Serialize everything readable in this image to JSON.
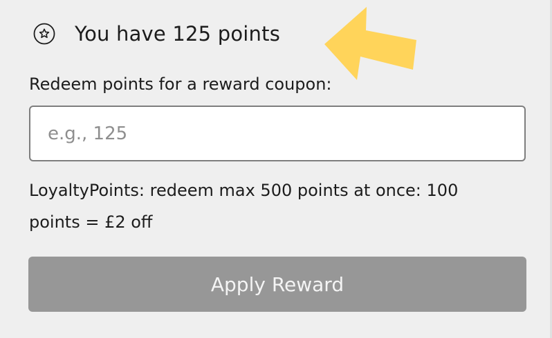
{
  "loyalty": {
    "points_message": "You have 125 points",
    "star_icon": "star-circle-icon",
    "redeem_label": "Redeem points for a reward coupon:",
    "input_placeholder": "e.g., 125",
    "input_value": "",
    "info_text": "LoyaltyPoints: redeem max 500 points at once: 100 points = £2 off",
    "apply_button_label": "Apply Reward"
  },
  "annotation": {
    "icon": "arrow-pointer-icon",
    "color": "#FFD45A"
  },
  "colors": {
    "background": "#efefef",
    "button_disabled": "#979797",
    "input_border": "#7d7d7d"
  }
}
